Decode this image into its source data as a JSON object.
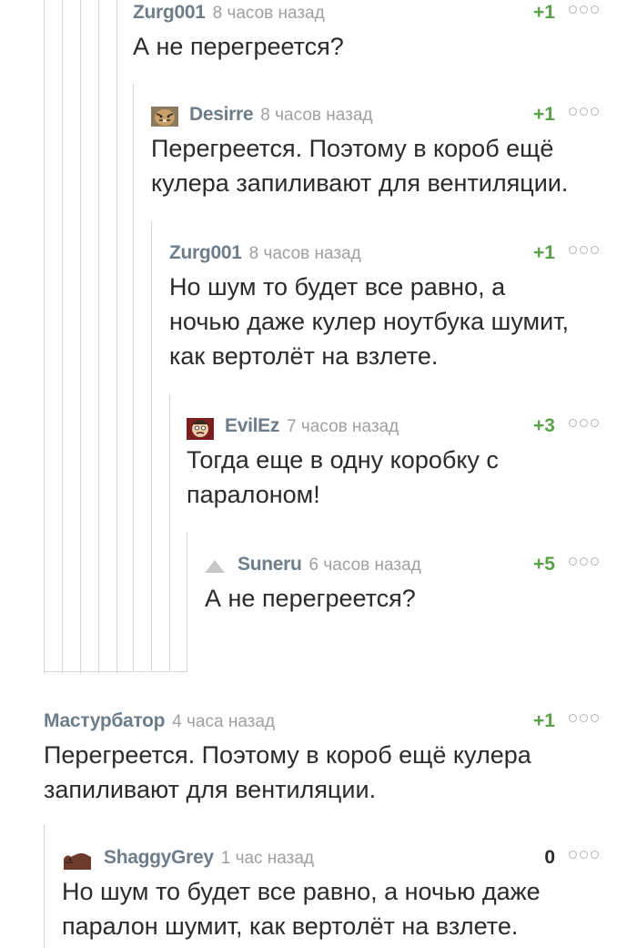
{
  "comments": [
    {
      "author": "Zurg001",
      "time": "8 часов назад",
      "score": "+1",
      "text_lines": [
        "А не перегреется?"
      ]
    },
    {
      "author": "Desirre",
      "time": "8 часов назад",
      "score": "+1",
      "text_lines": [
        "Перегреется. Поэтому в короб ещё",
        "кулера запиливают для вентиляции."
      ]
    },
    {
      "author": "Zurg001",
      "time": "8 часов назад",
      "score": "+1",
      "text_lines": [
        "Но шум то будет все равно, а",
        "ночью даже кулер ноутбука шумит,",
        "как вертолёт на взлете."
      ]
    },
    {
      "author": "EvilEz",
      "time": "7 часов назад",
      "score": "+3",
      "text_lines": [
        "Тогда еще в одну коробку с",
        "паралоном!"
      ]
    },
    {
      "author": "Suneru",
      "time": "6 часов назад",
      "score": "+5",
      "text_lines": [
        "А не перегреется?"
      ]
    },
    {
      "author": "Мастурбатор",
      "time": "4 часа назад",
      "score": "+1",
      "text_lines": [
        "Перегреется. Поэтому в короб ещё кулера",
        "запиливают для вентиляции."
      ]
    },
    {
      "author": "ShaggyGrey",
      "time": "1 час назад",
      "score": "0",
      "text_lines": [
        "Но шум то будет все равно, а ночью даже",
        "паралон шумит, как вертолёт на взлете."
      ]
    }
  ],
  "icons": {
    "desirre_avatar": "tiger-avatar-icon",
    "evilez_avatar": "face-avatar-icon",
    "suneru_avatar": "default-avatar-triangle-icon",
    "shaggygrey_avatar": "animal-avatar-icon",
    "more": "more-dots-icon"
  },
  "colors": {
    "author": "#6d7d8a",
    "time": "#a0a0a0",
    "score_positive": "#5aa24a",
    "text": "#2b2b2b",
    "thread_line": "#d6d6d6"
  }
}
